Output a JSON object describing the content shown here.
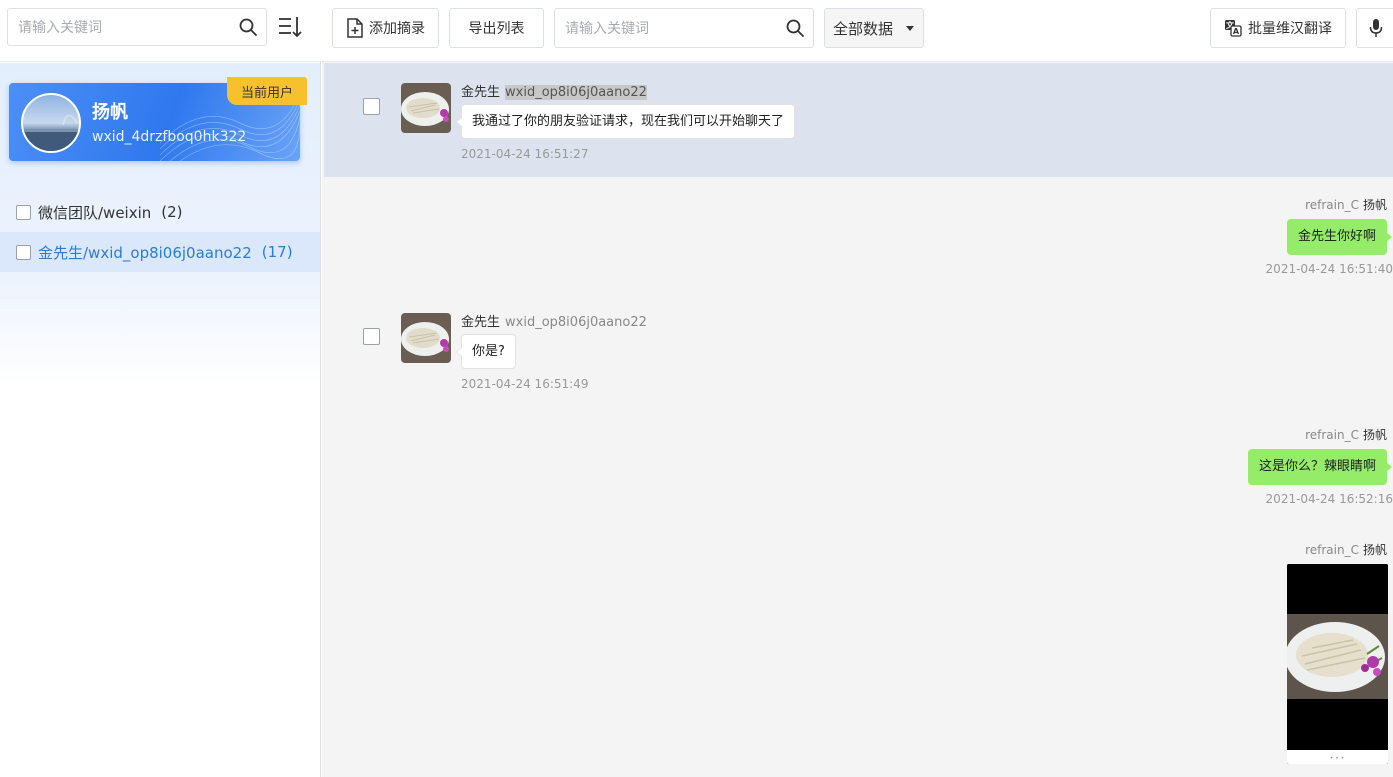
{
  "left": {
    "search_placeholder": "请输入关键词",
    "user": {
      "name": "扬帆",
      "wxid": "wxid_4drzfboq0hk322",
      "badge": "当前用户"
    },
    "contacts": [
      {
        "label": "微信团队/weixin",
        "count": "(2)"
      },
      {
        "label": "金先生/wxid_op8i06j0aano22",
        "count": "(17)"
      }
    ]
  },
  "toolbar": {
    "add_label": "添加摘录",
    "export_label": "导出列表",
    "search_placeholder": "请输入关键词",
    "filter_value": "全部数据",
    "translate_label": "批量维汉翻译"
  },
  "messages": [
    {
      "side": "left",
      "sender": "金先生",
      "wxid": "wxid_op8i06j0aano22",
      "text": "我通过了你的朋友验证请求，现在我们可以开始聊天了",
      "time": "2021-04-24 16:51:27"
    },
    {
      "side": "right",
      "sender_id": "refrain_C",
      "sender": "扬帆",
      "text": "金先生你好啊",
      "time": "2021-04-24 16:51:40"
    },
    {
      "side": "left",
      "sender": "金先生",
      "wxid": "wxid_op8i06j0aano22",
      "text": "你是?",
      "time": "2021-04-24 16:51:49"
    },
    {
      "side": "right",
      "sender_id": "refrain_C",
      "sender": "扬帆",
      "text": "这是你么？辣眼睛啊",
      "time": "2021-04-24 16:52:16"
    },
    {
      "side": "right",
      "sender_id": "refrain_C",
      "sender": "扬帆",
      "type": "image"
    }
  ],
  "colors": {
    "accent": "#2f78ee",
    "badge": "#f7c12e",
    "bubble_right": "#95ec69",
    "highlight_row": "#dce3ee"
  },
  "icons": [
    "search-icon",
    "sort-icon",
    "add-document-icon",
    "translate-icon",
    "microphone-icon",
    "dropdown-caret-icon"
  ]
}
